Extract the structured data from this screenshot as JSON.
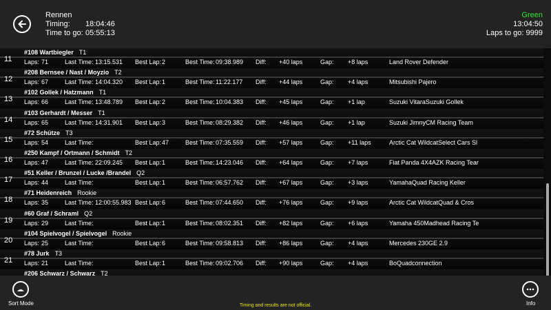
{
  "header": {
    "race_name": "Rennen",
    "timing_label": "Timing:",
    "timing_value": "18:04:46",
    "time_to_go_label": "Time to go:",
    "time_to_go_value": "05:55:13",
    "flag": "Green",
    "flag_color": "#2ee82e",
    "clock": "13:04:50",
    "laps_to_go_label": "Laps to go:",
    "laps_to_go_value": "9999"
  },
  "labels": {
    "laps": "Laps:",
    "last_time": "Last Time:",
    "best_lap": "Best Lap:",
    "best_time": "Best Time:",
    "diff": "Diff:",
    "gap": "Gap:"
  },
  "entries": [
    {
      "pos": "11",
      "no": "#108",
      "drivers": "Wartbiegler",
      "cls": "T1",
      "laps": "71",
      "last": "13:15.531",
      "best_lap": "2",
      "best_time": "09:38.989",
      "diff": "+40 laps",
      "gap": "+8 laps",
      "vehicle": "Land Rover Defender"
    },
    {
      "pos": "12",
      "no": "#208",
      "drivers": "Bernsee / Nast / Moyzio",
      "cls": "T2",
      "laps": "67",
      "last": "14:04.320",
      "best_lap": "1",
      "best_time": "11:22.177",
      "diff": "+44 laps",
      "gap": "+4 laps",
      "vehicle": "Mitsubishi Pajero"
    },
    {
      "pos": "13",
      "no": "#102",
      "drivers": "Gollek / Hatzmann",
      "cls": "T1",
      "laps": "66",
      "last": "13:48.789",
      "best_lap": "2",
      "best_time": "10:04.383",
      "diff": "+45 laps",
      "gap": "+1 lap",
      "vehicle": "Suzuki VitaraSuzuki Gollek"
    },
    {
      "pos": "14",
      "no": "#103",
      "drivers": "Gerhardt / Messer",
      "cls": "T1",
      "laps": "65",
      "last": "14:31.901",
      "best_lap": "3",
      "best_time": "08:29.382",
      "diff": "+46 laps",
      "gap": "+1 lap",
      "vehicle": "Suzuki JimnyCM Racing Team"
    },
    {
      "pos": "15",
      "no": "#72",
      "drivers": "Schütze",
      "cls": "T3",
      "laps": "54",
      "last": "",
      "best_lap": "47",
      "best_time": "07:35.559",
      "diff": "+57 laps",
      "gap": "+11 laps",
      "vehicle": "Arctic Cat WildcatSelect Cars Sl"
    },
    {
      "pos": "16",
      "no": "#250",
      "drivers": "Kampf / Ortmann / Schmidt",
      "cls": "T2",
      "laps": "47",
      "last": "22:09.245",
      "best_lap": "1",
      "best_time": "14:23.046",
      "diff": "+64 laps",
      "gap": "+7 laps",
      "vehicle": "Fiat Panda 4X4AZK Racing Tear"
    },
    {
      "pos": "17",
      "no": "#51",
      "drivers": "Keller / Brunzel / Lucke /Brandel",
      "cls": "Q2",
      "laps": "44",
      "last": "",
      "best_lap": "1",
      "best_time": "06:57.762",
      "diff": "+67 laps",
      "gap": "+3 laps",
      "vehicle": "YamahaQuad Racing Keller"
    },
    {
      "pos": "18",
      "no": "#71",
      "drivers": "Heidenreich",
      "cls": "Rookie",
      "laps": "35",
      "last": "12:00:55.983",
      "best_lap": "6",
      "best_time": "07:44.650",
      "diff": "+76 laps",
      "gap": "+9 laps",
      "vehicle": "Arctic Cat WildcatQuad & Cros"
    },
    {
      "pos": "19",
      "no": "#60",
      "drivers": "Graf / Schraml",
      "cls": "Q2",
      "laps": "29",
      "last": "",
      "best_lap": "1",
      "best_time": "08:02.351",
      "diff": "+82 laps",
      "gap": "+6 laps",
      "vehicle": "Yamaha 450Madhead Racing Te"
    },
    {
      "pos": "20",
      "no": "#104",
      "drivers": "Spielvogel / Spielvogel",
      "cls": "Rookie",
      "laps": "25",
      "last": "",
      "best_lap": "6",
      "best_time": "09:58.813",
      "diff": "+86 laps",
      "gap": "+4 laps",
      "vehicle": "Mercedes 230GE 2.9"
    },
    {
      "pos": "21",
      "no": "#78",
      "drivers": "Jurk",
      "cls": "T3",
      "laps": "21",
      "last": "",
      "best_lap": "1",
      "best_time": "09:02.706",
      "diff": "+90 laps",
      "gap": "+4 laps",
      "vehicle": "BoQuadconnection"
    },
    {
      "pos": "",
      "no": "#206",
      "drivers": "Schwarz / Schwarz",
      "cls": "T2",
      "laps": "",
      "last": "",
      "best_lap": "",
      "best_time": "",
      "diff": "",
      "gap": "",
      "vehicle": ""
    }
  ],
  "footer": {
    "sort_label": "Sort Mode",
    "notice": "Timing and results are not official.",
    "notice_color": "#e8e800",
    "info_label": "Info"
  },
  "icons": {
    "back": "back-arrow-icon",
    "sort": "sort-mode-icon",
    "info": "more-dots-icon"
  }
}
